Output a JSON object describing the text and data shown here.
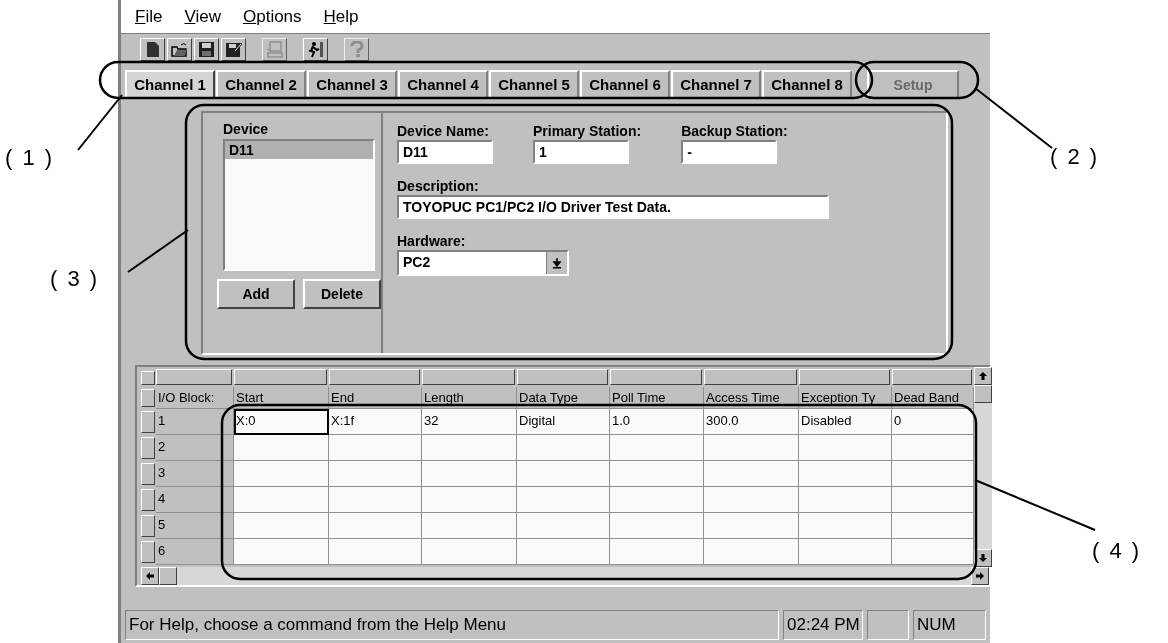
{
  "menu": [
    {
      "label": "File"
    },
    {
      "label": "View"
    },
    {
      "label": "Options"
    },
    {
      "label": "Help"
    }
  ],
  "toolbar": [
    {
      "kind": "new",
      "disabled": false
    },
    {
      "kind": "open",
      "disabled": false
    },
    {
      "kind": "save",
      "disabled": false
    },
    {
      "kind": "save-as",
      "disabled": false
    },
    {
      "kind": "computer",
      "disabled": true
    },
    {
      "kind": "exit",
      "disabled": false
    },
    {
      "kind": "help",
      "disabled": true
    }
  ],
  "tabs": [
    {
      "label": "Channel 1",
      "selected": true
    },
    {
      "label": "Channel 2",
      "selected": false
    },
    {
      "label": "Channel 3",
      "selected": false
    },
    {
      "label": "Channel 4",
      "selected": false
    },
    {
      "label": "Channel 5",
      "selected": false
    },
    {
      "label": "Channel 6",
      "selected": false
    },
    {
      "label": "Channel 7",
      "selected": false
    },
    {
      "label": "Channel 8",
      "selected": false
    }
  ],
  "setup_button": {
    "label": "Setup",
    "disabled": true
  },
  "device_panel": {
    "list_label": "Device",
    "items": [
      {
        "label": "D11",
        "selected": true
      }
    ],
    "buttons": [
      "Add",
      "Delete"
    ],
    "device_name": {
      "label": "Device Name:",
      "value": "D11"
    },
    "primary_station": {
      "label": "Primary Station:",
      "value": "1"
    },
    "backup_station": {
      "label": "Backup Station:",
      "value": "-"
    },
    "description": {
      "label": "Description:",
      "value": "TOYOPUC PC1/PC2 I/O Driver Test Data."
    },
    "hardware": {
      "label": "Hardware:",
      "value": "PC2"
    }
  },
  "grid": {
    "columns": [
      "I/O Block:",
      "Start",
      "End",
      "Length",
      "Data Type",
      "Poll Time",
      "Access Time",
      "Exception Ty",
      "Dead Band"
    ],
    "rows": [
      {
        "label": "1",
        "cells": [
          {
            "value": "X:0",
            "selected": true
          },
          {
            "value": "X:1f",
            "selected": false
          },
          {
            "value": "32",
            "selected": false
          },
          {
            "value": "Digital",
            "selected": false
          },
          {
            "value": "1.0",
            "selected": false
          },
          {
            "value": "300.0",
            "selected": false
          },
          {
            "value": "Disabled",
            "selected": false
          },
          {
            "value": "0",
            "selected": false
          }
        ]
      },
      {
        "label": "2"
      },
      {
        "label": "3"
      },
      {
        "label": "4"
      },
      {
        "label": "5"
      },
      {
        "label": "6"
      }
    ]
  },
  "status_bar": {
    "message": "For Help, choose a command from the Help Menu",
    "time": "02:24 PM",
    "indicator": "NUM"
  },
  "annotations": [
    {
      "label": "( 1 )"
    },
    {
      "label": "( 2 )"
    },
    {
      "label": "( 3 )"
    },
    {
      "label": "( 4 )"
    }
  ]
}
